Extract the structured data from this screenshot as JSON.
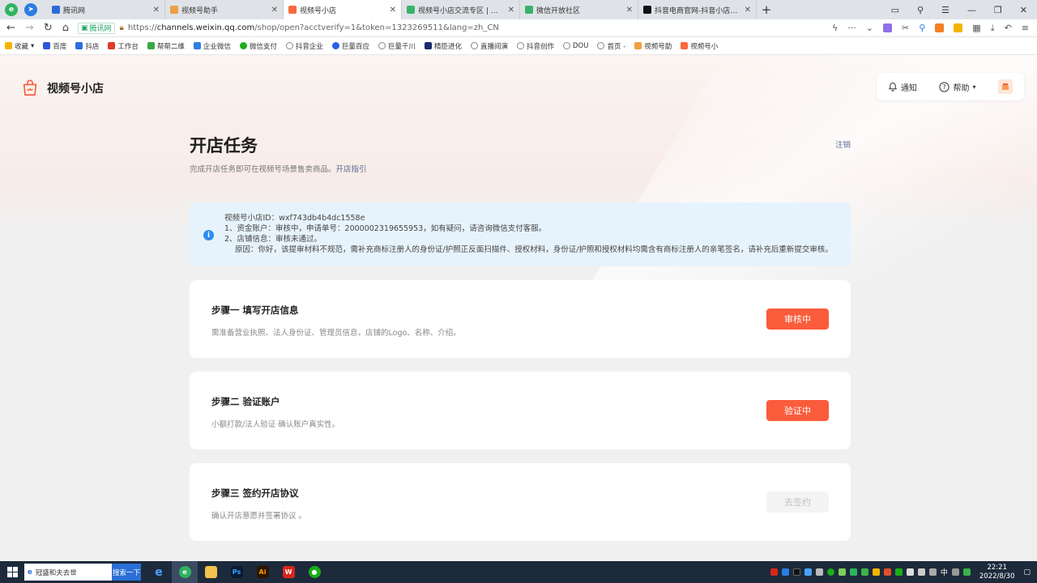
{
  "browser": {
    "tabs": [
      {
        "label": "腾讯网",
        "color": "#2f6bd8",
        "active": false
      },
      {
        "label": "视频号助手",
        "color": "#f0a040",
        "active": false
      },
      {
        "label": "视频号小店",
        "color": "#fa6a3c",
        "active": true
      },
      {
        "label": "视频号小店交流专区 | 微信开放",
        "color": "#39b36b",
        "active": false
      },
      {
        "label": "微信开放社区",
        "color": "#39b36b",
        "active": false
      },
      {
        "label": "抖音电商官网-抖音小店入驻 | 抖",
        "color": "#111111",
        "active": false
      }
    ],
    "new_tab": "+",
    "url": {
      "site_badge": "腾讯网",
      "scheme": "https://",
      "host": "channels.weixin.qq.com",
      "path": "/shop/open?acctverify=1&token=1323269511&lang=zh_CN"
    },
    "bookmarks": [
      {
        "label": "收藏",
        "color": "#f5b400"
      },
      {
        "label": "百度",
        "color": "#3155d8"
      },
      {
        "label": "抖店",
        "color": "#2a6ee0"
      },
      {
        "label": "工作台",
        "color": "#e03b2a"
      },
      {
        "label": "帮帮二维",
        "color": "#39a845"
      },
      {
        "label": "企业微信",
        "color": "#2e7fe0"
      },
      {
        "label": "微信支付",
        "color": "#1aad19"
      },
      {
        "label": "抖音企业",
        "color": "#888888"
      },
      {
        "label": "巨量百应",
        "color": "#2a5ee8"
      },
      {
        "label": "巨量千川",
        "color": "#888888"
      },
      {
        "label": "精臣进化",
        "color": "#1a2a6e"
      },
      {
        "label": "直播间演",
        "color": "#888888"
      },
      {
        "label": "抖音创作",
        "color": "#888888"
      },
      {
        "label": "DOU",
        "color": "#888888"
      },
      {
        "label": "首页 -",
        "color": "#888888"
      },
      {
        "label": "视频号助",
        "color": "#f0a040"
      },
      {
        "label": "视频号小",
        "color": "#fa6a3c"
      }
    ]
  },
  "page": {
    "brand": "视频号小店",
    "top_right": {
      "notify": "通知",
      "help": "帮助"
    },
    "title": "开店任务",
    "subtitle": "完成开店任务即可在视频号场景售卖商品。",
    "guide_link": "开店指引",
    "logout": "注销",
    "notice": {
      "line1": "视频号小店ID：wxf743db4b4dc1558e",
      "line2": "1、资金账户：审核中，申请单号：2000002319655953，如有疑问，请咨询微信支付客服。",
      "line3": "2、店铺信息：审核未通过。",
      "line4": "原因：你好，该提审材料不规范，需补充商标注册人的身份证/护照正反面扫描件、授权材料，身份证/护照和授权材料均需含有商标注册人的亲笔签名，请补充后重新提交审核。"
    },
    "steps": [
      {
        "title": "步骤一   填写开店信息",
        "desc": "需准备营业执照、法人身份证、管理员信息，店铺的Logo、名称、介绍。",
        "button": "审核中",
        "enabled": true
      },
      {
        "title": "步骤二   验证账户",
        "desc": "小额打款/法人验证 确认账户真实性。",
        "button": "验证中",
        "enabled": true
      },
      {
        "title": "步骤三   签约开店协议",
        "desc": "确认开店意愿并签署协议 。",
        "button": "去签约",
        "enabled": false
      }
    ]
  },
  "taskbar": {
    "search_text": "冠盛和夫去世",
    "search_button": "搜索一下",
    "time": "22:21",
    "date": "2022/8/30",
    "ime": "中"
  }
}
